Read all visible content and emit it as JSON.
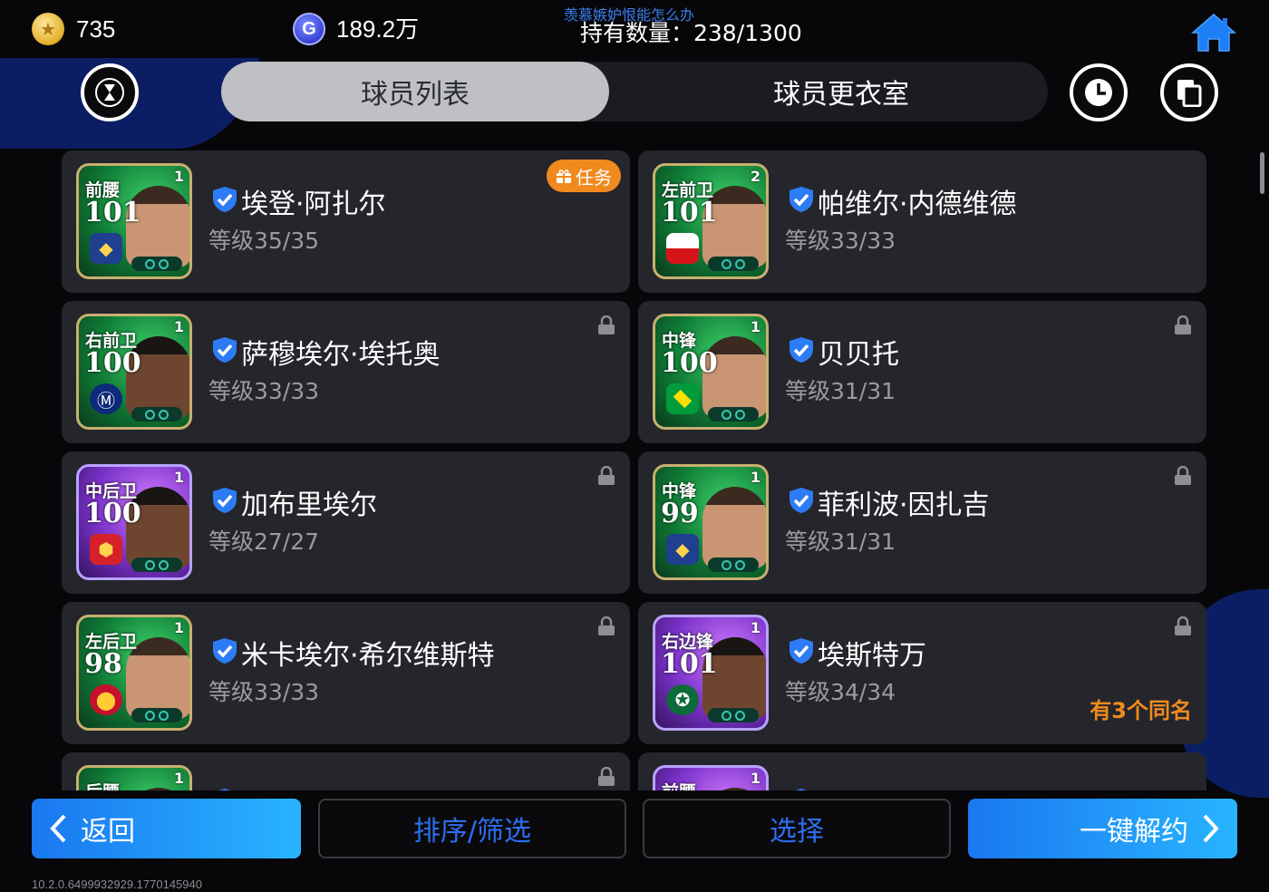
{
  "header": {
    "gold_coins": "735",
    "gold_coin_icon": "star-coin-icon",
    "gp_coins": "189.2万",
    "gp_coin_symbol": "G",
    "watermark": "羡慕嫉妒恨能怎么办",
    "holding": "持有数量：238/1300",
    "home_icon": "home-icon"
  },
  "tabs": [
    {
      "label": "球员列表",
      "active": true
    },
    {
      "label": "球员更衣室",
      "active": false
    }
  ],
  "players": [
    {
      "position": "前腰",
      "rating": "101",
      "level_badge": "1",
      "name": "埃登·阿扎尔",
      "level": "等级35/35",
      "frame": "green",
      "crest": "club-crest",
      "task": "任务",
      "locked": false
    },
    {
      "position": "左前卫",
      "rating": "101",
      "level_badge": "2",
      "name": "帕维尔·内德维德",
      "level": "等级33/33",
      "frame": "green",
      "crest": "czech-flag",
      "locked": false
    },
    {
      "position": "右前卫",
      "rating": "100",
      "level_badge": "1",
      "name": "萨穆埃尔·埃托奥",
      "level": "等级33/33",
      "frame": "green",
      "crest": "inter-crest",
      "locked": true
    },
    {
      "position": "中锋",
      "rating": "100",
      "level_badge": "1",
      "name": "贝贝托",
      "level": "等级31/31",
      "frame": "green",
      "crest": "brazil-flag",
      "locked": true
    },
    {
      "position": "中后卫",
      "rating": "100",
      "level_badge": "1",
      "name": "加布里埃尔",
      "level": "等级27/27",
      "frame": "purple",
      "crest": "arsenal-crest",
      "locked": true
    },
    {
      "position": "中锋",
      "rating": "99",
      "level_badge": "1",
      "name": "菲利波·因扎吉",
      "level": "等级31/31",
      "frame": "green",
      "crest": "club-crest",
      "locked": true
    },
    {
      "position": "左后卫",
      "rating": "98",
      "level_badge": "1",
      "name": "米卡埃尔·希尔维斯特",
      "level": "等级33/33",
      "frame": "green",
      "crest": "manutd-crest",
      "locked": true
    },
    {
      "position": "右边锋",
      "rating": "101",
      "level_badge": "1",
      "name": "埃斯特万",
      "level": "等级34/34",
      "frame": "purple",
      "crest": "palmeiras-crest",
      "locked": true,
      "same_name": "有3个同名"
    },
    {
      "position": "后腰",
      "rating": "",
      "level_badge": "1",
      "name": "",
      "level": "",
      "frame": "green",
      "locked": true
    },
    {
      "position": "前腰",
      "rating": "",
      "level_badge": "1",
      "name": "",
      "level": "",
      "frame": "purple",
      "locked": false
    }
  ],
  "footer": {
    "back": "返回",
    "sort": "排序/筛选",
    "select": "选择",
    "release": "一键解约",
    "version": "10.2.0.6499932929.1770145940"
  },
  "colors": {
    "accent_blue": "#1a78f0",
    "accent_orange": "#f08a1e",
    "card_bg": "#25262b",
    "verify_blue": "#2d7cf6"
  }
}
